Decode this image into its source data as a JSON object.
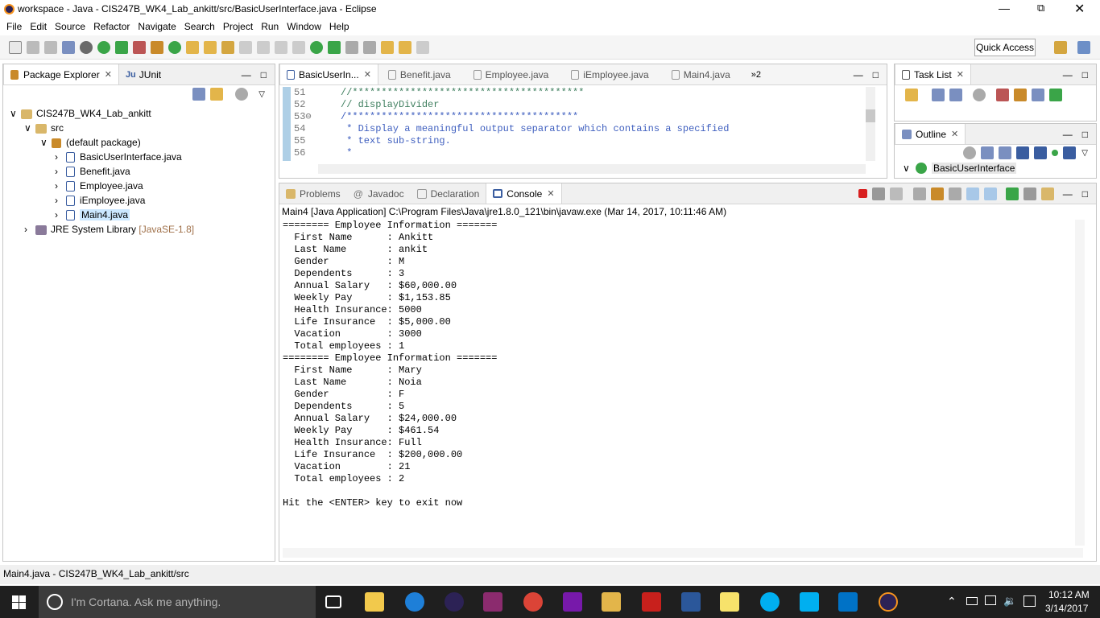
{
  "window": {
    "title": "workspace - Java - CIS247B_WK4_Lab_ankitt/src/BasicUserInterface.java - Eclipse"
  },
  "menu": [
    "File",
    "Edit",
    "Source",
    "Refactor",
    "Navigate",
    "Search",
    "Project",
    "Run",
    "Window",
    "Help"
  ],
  "quick_access": "Quick Access",
  "package_explorer": {
    "tabs": [
      "Package Explorer",
      "JUnit"
    ],
    "project": "CIS247B_WK4_Lab_ankitt",
    "src": "src",
    "package": "(default package)",
    "files": [
      "BasicUserInterface.java",
      "Benefit.java",
      "Employee.java",
      "iEmployee.java",
      "Main4.java"
    ],
    "jre": "JRE System Library",
    "jre_version": "[JavaSE-1.8]"
  },
  "editor": {
    "tabs": [
      "BasicUserIn...",
      "Benefit.java",
      "Employee.java",
      "iEmployee.java",
      "Main4.java"
    ],
    "overflow": "»2",
    "lines": [
      {
        "n": "51",
        "text": "//****************************************"
      },
      {
        "n": "52",
        "text": "// displayDivider"
      },
      {
        "n": "53⊖",
        "text": "/****************************************"
      },
      {
        "n": "54",
        "text": " * Display a meaningful output separator which contains a specified"
      },
      {
        "n": "55",
        "text": " * text sub-string."
      },
      {
        "n": "56",
        "text": " *"
      }
    ]
  },
  "task_list": {
    "tab": "Task List"
  },
  "outline": {
    "tab": "Outline",
    "item": "BasicUserInterface"
  },
  "console": {
    "tabs": [
      "Problems",
      "Javadoc",
      "Declaration",
      "Console"
    ],
    "header": "Main4 [Java Application] C:\\Program Files\\Java\\jre1.8.0_121\\bin\\javaw.exe (Mar 14, 2017, 10:11:46 AM)",
    "lines": [
      "======== Employee Information =======",
      "  First Name      : Ankitt",
      "  Last Name       : ankit",
      "  Gender          : M",
      "  Dependents      : 3",
      "  Annual Salary   : $60,000.00",
      "  Weekly Pay      : $1,153.85",
      "  Health Insurance: 5000",
      "  Life Insurance  : $5,000.00",
      "  Vacation        : 3000",
      "  Total employees : 1",
      "======== Employee Information =======",
      "  First Name      : Mary",
      "  Last Name       : Noia",
      "  Gender          : F",
      "  Dependents      : 5",
      "  Annual Salary   : $24,000.00",
      "  Weekly Pay      : $461.54",
      "  Health Insurance: Full",
      "  Life Insurance  : $200,000.00",
      "  Vacation        : 21",
      "  Total employees : 2",
      "",
      "Hit the <ENTER> key to exit now"
    ]
  },
  "status": "Main4.java - CIS247B_WK4_Lab_ankitt/src",
  "taskbar": {
    "search": "I'm Cortana. Ask me anything.",
    "time": "10:12 AM",
    "date": "3/14/2017"
  }
}
